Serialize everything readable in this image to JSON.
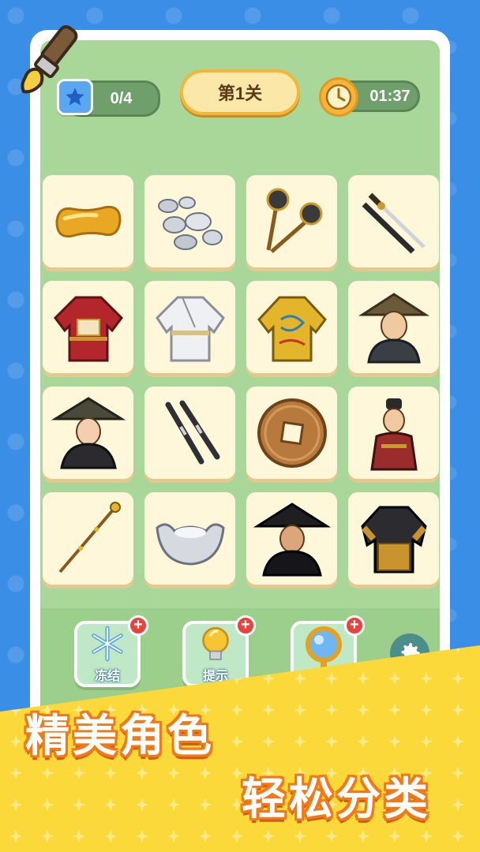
{
  "header": {
    "stars_progress": "0/4",
    "level_title": "第1关",
    "timer": "01:37"
  },
  "grid": {
    "tiles": [
      {
        "item": "gold-ingot-bar"
      },
      {
        "item": "silver-ore-pile"
      },
      {
        "item": "twin-maces"
      },
      {
        "item": "sword-and-scabbard"
      },
      {
        "item": "red-official-robe"
      },
      {
        "item": "white-robe"
      },
      {
        "item": "golden-dragon-robe"
      },
      {
        "item": "straw-hat-warrior"
      },
      {
        "item": "straw-hat-woman"
      },
      {
        "item": "twin-batons"
      },
      {
        "item": "bronze-coin"
      },
      {
        "item": "general-character"
      },
      {
        "item": "golden-staff"
      },
      {
        "item": "silver-yuanbao"
      },
      {
        "item": "black-hat-swordsman"
      },
      {
        "item": "golden-armor"
      }
    ]
  },
  "boosters": {
    "freeze_label": "冻结",
    "hint_label": "提示",
    "magnifier_label": ""
  },
  "promo": {
    "line1": "精美角色",
    "line2": "轻松分类"
  },
  "colors": {
    "background": "#3b8ee6",
    "board": "#a9d79a",
    "tile": "#fff7d9",
    "banner": "#fbd93a",
    "slogan_outline": "#f07a1a"
  }
}
